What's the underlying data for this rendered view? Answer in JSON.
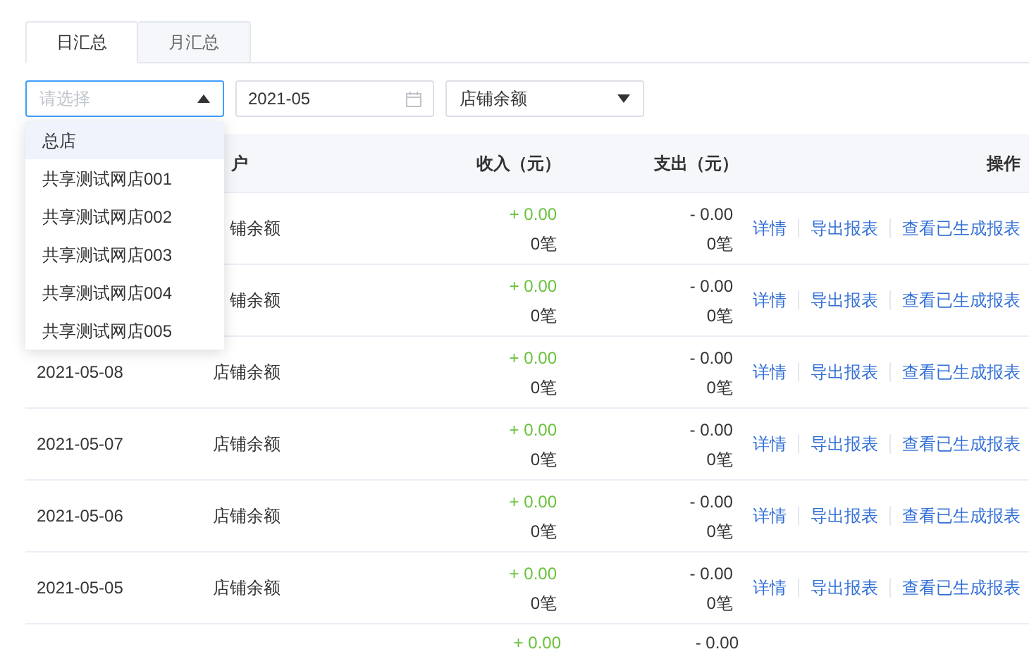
{
  "tabs": [
    {
      "label": "日汇总",
      "selected": true
    },
    {
      "label": "月汇总",
      "selected": false
    }
  ],
  "filters": {
    "store_select": {
      "placeholder": "请选择",
      "expanded": true
    },
    "month_field": {
      "value": "2021-05"
    },
    "account_select": {
      "value": "店铺余额"
    }
  },
  "store_options": [
    {
      "label": "总店",
      "selected": true
    },
    {
      "label": "共享测试网店001",
      "selected": false
    },
    {
      "label": "共享测试网店002",
      "selected": false
    },
    {
      "label": "共享测试网店003",
      "selected": false
    },
    {
      "label": "共享测试网店004",
      "selected": false
    },
    {
      "label": "共享测试网店005",
      "selected": false
    }
  ],
  "table": {
    "columns": {
      "account": "户",
      "income": "收入（元）",
      "expense": "支出（元）",
      "actions": "操作"
    },
    "rows": [
      {
        "account": "铺余额",
        "income": "+ 0.00",
        "income_count": "0笔",
        "expense": "- 0.00",
        "expense_count": "0笔",
        "actions": [
          "详情",
          "导出报表",
          "查看已生成报表"
        ]
      },
      {
        "account": "铺余额",
        "income": "+ 0.00",
        "income_count": "0笔",
        "expense": "- 0.00",
        "expense_count": "0笔",
        "actions": [
          "详情",
          "导出报表",
          "查看已生成报表"
        ]
      },
      {
        "date": "2021-05-08",
        "account": "店铺余额",
        "income": "+ 0.00",
        "income_count": "0笔",
        "expense": "- 0.00",
        "expense_count": "0笔",
        "actions": [
          "详情",
          "导出报表",
          "查看已生成报表"
        ]
      },
      {
        "date": "2021-05-07",
        "account": "店铺余额",
        "income": "+ 0.00",
        "income_count": "0笔",
        "expense": "- 0.00",
        "expense_count": "0笔",
        "actions": [
          "详情",
          "导出报表",
          "查看已生成报表"
        ]
      },
      {
        "date": "2021-05-06",
        "account": "店铺余额",
        "income": "+ 0.00",
        "income_count": "0笔",
        "expense": "- 0.00",
        "expense_count": "0笔",
        "actions": [
          "详情",
          "导出报表",
          "查看已生成报表"
        ]
      },
      {
        "date": "2021-05-05",
        "account": "店铺余额",
        "income": "+ 0.00",
        "income_count": "0笔",
        "expense": "- 0.00",
        "expense_count": "0笔",
        "actions": [
          "详情",
          "导出报表",
          "查看已生成报表"
        ]
      },
      {
        "income": "+ 0.00",
        "expense": "- 0.00"
      }
    ]
  }
}
